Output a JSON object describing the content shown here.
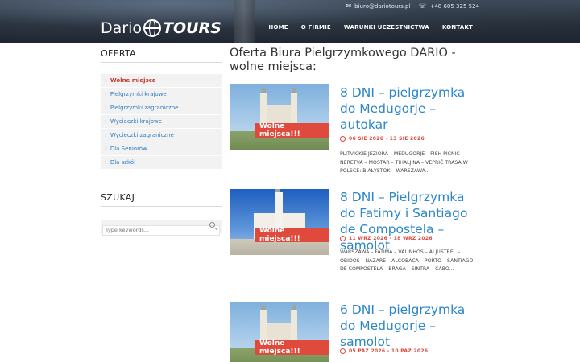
{
  "header": {
    "email": "biuro@dariotours.pl",
    "phone": "+48 605 325 524",
    "logo_part1": "Dario",
    "logo_part2": "TOURS",
    "nav": [
      "HOME",
      "O FIRMIE",
      "WARUNKI UCZESTNICTWA",
      "KONTAKT"
    ]
  },
  "sidebar": {
    "offer_title": "OFERTA",
    "items": [
      {
        "label": "Wolne miejsca",
        "active": true
      },
      {
        "label": "Pielgrzymki krajowe",
        "active": false
      },
      {
        "label": "Pielgrzymki zagraniczne",
        "active": false
      },
      {
        "label": "Wycieczki krajowe",
        "active": false
      },
      {
        "label": "Wycieczki zagraniczne",
        "active": false
      },
      {
        "label": "Dla Seniorów",
        "active": false
      },
      {
        "label": "Dla szkół",
        "active": false
      }
    ],
    "search_title": "SZUKAJ",
    "search_placeholder": "Type keywords..."
  },
  "main": {
    "page_title": "Oferta Biura Pielgrzymkowego DARIO - wolne miejsca:",
    "posts": [
      {
        "badge": "Wolne miejsca!!!",
        "title": "8 DNI – pielgrzymka do Medugorje – autokar",
        "date": "06 SIE 2026 - 13 SIE 2026",
        "desc": "PLITVICKIE JEZIORA – MEDUGORJE – FISH PICNIC NERETVA – MOSTAR – TIHALJINA – VEPRIĆ   TRASA W POLSCE: BIAŁYSTOK – WARSZAWA..."
      },
      {
        "badge": "Wolne miejsca!!!",
        "title": "8 DNI – Pielgrzymka do Fatimy i Santiago de Compostela – samolot",
        "date": "11 WRZ 2026 - 18 WRZ 2026",
        "desc": "  WARSZAWA – FATIMA – VALINHOS – ALJUSTREL – OBIDOS – NAZARE – ALCOBACA – PORTO – SANTIAGO DE COMPOSTELA – BRAGA – SINTRA – CABO..."
      },
      {
        "badge": "Wolne miejsca!!!",
        "title": "6 DNI – pielgrzymka do Medugorje – samolot",
        "date": "05 PAŹ 2026 - 10 PAŹ 2026",
        "desc": ""
      }
    ]
  }
}
